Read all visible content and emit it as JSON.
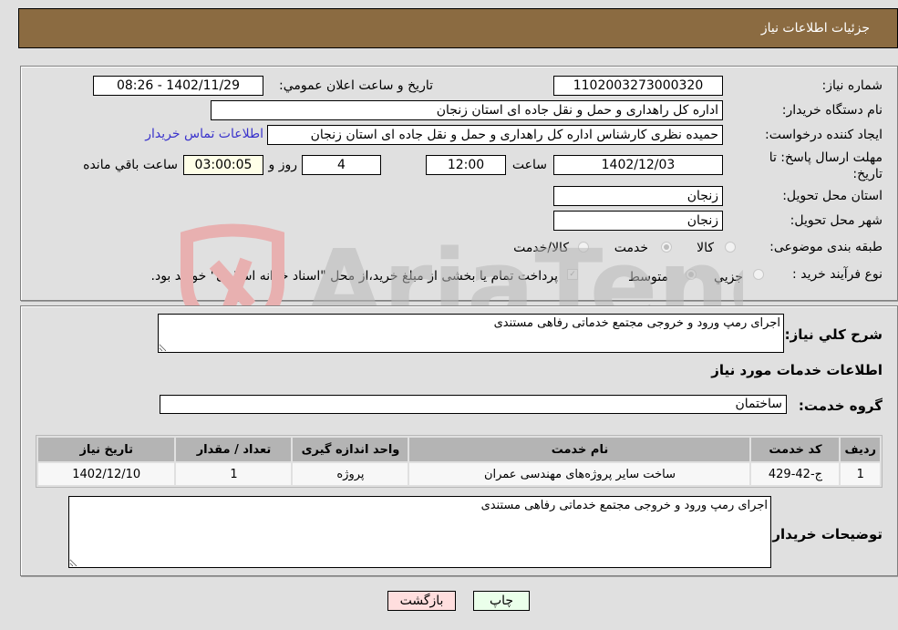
{
  "header": {
    "title": "جزئیات اطلاعات نیاز"
  },
  "fields": {
    "need_number": {
      "label": "شماره نیاز:",
      "value": "1102003273000320"
    },
    "announce_datetime": {
      "label": "تاریخ و ساعت اعلان عمومي:",
      "value": "1402/11/29 - 08:26"
    },
    "buyer_org": {
      "label": "نام دستگاه خریدار:",
      "value": "اداره کل راهداری و حمل و نقل جاده ای استان زنجان"
    },
    "requester": {
      "label": "ایجاد کننده درخواست:",
      "value": "حمیده نظری کارشناس اداره کل راهداری و حمل و نقل جاده ای استان زنجان"
    },
    "buyer_contact_link": "اطلاعات تماس خریدار",
    "deadline": {
      "label": "مهلت ارسال پاسخ: تا تاریخ:",
      "date": "1402/12/03",
      "time_label": "ساعت",
      "time": "12:00",
      "days": "4",
      "days_label": "روز و",
      "remaining": "03:00:05",
      "remaining_label": "ساعت باقي مانده"
    },
    "delivery_province": {
      "label": "استان محل تحویل:",
      "value": "زنجان"
    },
    "delivery_city": {
      "label": "شهر محل تحویل:",
      "value": "زنجان"
    },
    "category": {
      "label": "طبقه بندی موضوعی:",
      "options": [
        "کالا",
        "خدمت",
        "کالا/خدمت"
      ],
      "selected": "خدمت"
    },
    "process_type": {
      "label": "نوع فرآیند خرید :",
      "options": [
        "جزيي",
        "متوسط"
      ],
      "selected": "متوسط",
      "treasury_checkbox_label": "پرداخت تمام یا بخشی از مبلغ خرید،از محل \"اسناد خزانه اسلامی\" خواهد بود.",
      "treasury_checked": true
    }
  },
  "description": {
    "label": "شرح كلي نياز:",
    "value": "اجرای رمپ ورود و خروجی مجتمع خدماتی رفاهی مستندی"
  },
  "services_section": {
    "title": "اطلاعات خدمات مورد نیاز",
    "group_label": "گروه خدمت:",
    "group_value": "ساختمان"
  },
  "table": {
    "headers": [
      "ردیف",
      "کد خدمت",
      "نام خدمت",
      "واحد اندازه گیری",
      "تعداد / مقدار",
      "تاریخ نیاز"
    ],
    "rows": [
      [
        "1",
        "ج-42-429",
        "ساخت سایر پروژه‌های مهندسی عمران",
        "پروژه",
        "1",
        "1402/12/10"
      ]
    ]
  },
  "buyer_notes": {
    "label": "توضیحات خریدار:",
    "value": "اجرای رمپ ورود و خروجی مجتمع خدماتی رفاهی مستندی"
  },
  "buttons": {
    "print": "چاپ",
    "back": "بازگشت"
  },
  "watermark": {
    "text": "AriaTender.neT"
  }
}
